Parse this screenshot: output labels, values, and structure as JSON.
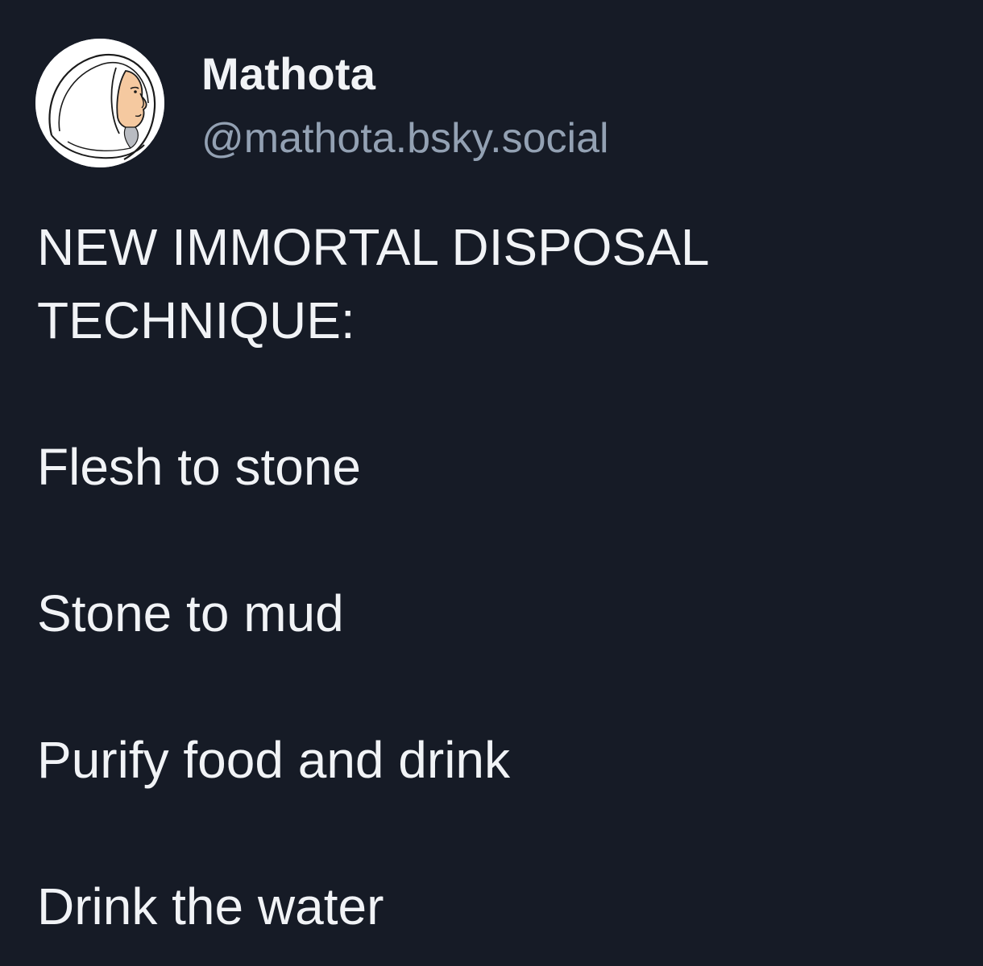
{
  "author": {
    "display_name": "Mathota",
    "handle": "@mathota.bsky.social",
    "avatar_icon": "hooded-figure-avatar"
  },
  "post": {
    "heading_lines": [
      "NEW IMMORTAL DISPOSAL",
      "TECHNIQUE:"
    ],
    "items": [
      "Flesh to stone",
      "Stone to mud",
      "Purify food and drink",
      "Drink the water"
    ]
  },
  "colors": {
    "background": "#161b26",
    "text": "#f1f3f6",
    "handle": "#93a1b3"
  }
}
